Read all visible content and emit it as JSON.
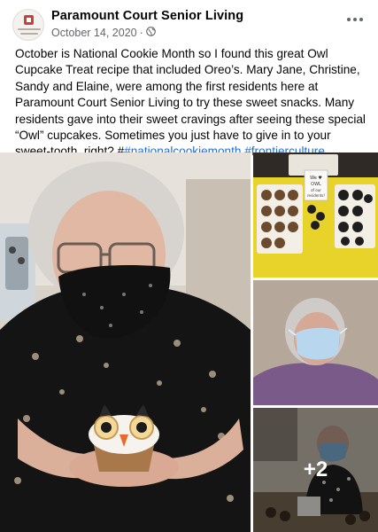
{
  "post": {
    "page_name": "Paramount Court Senior Living",
    "date": "October 14, 2020",
    "separator": "·",
    "privacy_icon": "globe-icon",
    "more_icon": "more-options-icon",
    "body_text": "October is National Cookie Month so I found this great Owl Cupcake Treat recipe that included Oreo’s.  Mary Jane, Christine, Sandy and Elaine, were among the first residents here at Paramount Court Senior Living to try these sweet snacks.  Many residents gave into their sweet cravings after seeing these special “Owl” cupcakes.  Sometimes you just have to give in to your sweet-tooth, right? #",
    "hashtags": [
      "#nationalcookiemonth",
      "#frontierculture"
    ]
  },
  "photos": {
    "main_alt": "Resident wearing a patterned face mask holding an owl cupcake",
    "top_right_alt": "Trays of owl cupcakes on a yellow table",
    "top_right_sign": "We ♥ OWL of our residents!",
    "middle_right_alt": "Resident wearing a blue surgical mask",
    "bottom_right_alt": "Resident wearing a mask beside a table of cupcakes",
    "more_count": "+2"
  },
  "colors": {
    "link": "#216fdb",
    "secondary_text": "#65676b",
    "logo_red": "#c9413a"
  }
}
